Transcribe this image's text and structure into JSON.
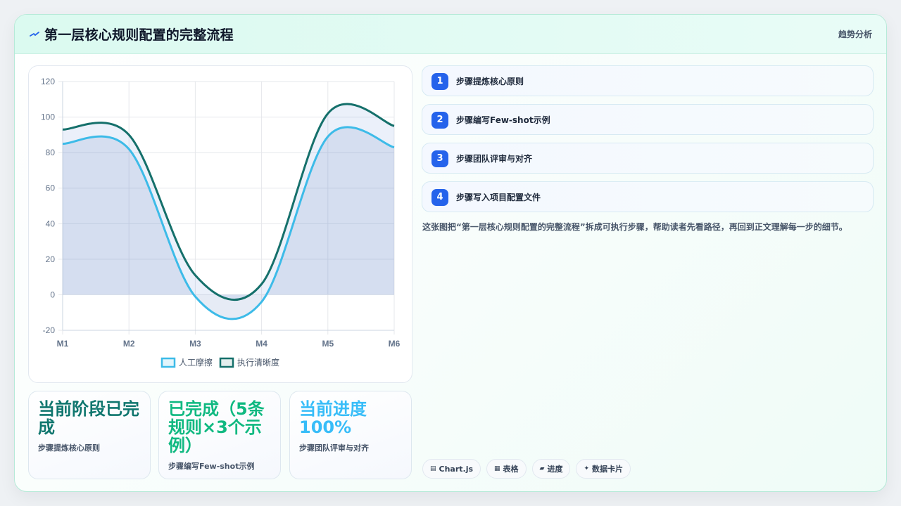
{
  "header": {
    "title": "第一层核心规则配置的完整流程",
    "tag": "趋势分析",
    "icon": "sparkle-icon"
  },
  "chart_data": {
    "type": "line",
    "categories": [
      "M1",
      "M2",
      "M3",
      "M4",
      "M5",
      "M6"
    ],
    "series": [
      {
        "name": "人工摩擦",
        "color": "#3dbbe8",
        "values": [
          85,
          82,
          -1,
          -4,
          89,
          83
        ]
      },
      {
        "name": "执行清晰度",
        "color": "#15706b",
        "values": [
          93,
          90,
          11,
          6,
          102,
          95
        ]
      }
    ],
    "ylim": [
      -20,
      120
    ],
    "yticks": [
      -20,
      0,
      20,
      40,
      60,
      80,
      100,
      120
    ],
    "grid": true,
    "legend": "bottom",
    "smooth": true,
    "fill": true
  },
  "steps": [
    {
      "num": "1",
      "label": "步骤提炼核心原则"
    },
    {
      "num": "2",
      "label": "步骤编写Few-shot示例"
    },
    {
      "num": "3",
      "label": "步骤团队评审与对齐"
    },
    {
      "num": "4",
      "label": "步骤写入项目配置文件"
    }
  ],
  "description": "这张图把“第一层核心规则配置的完整流程”拆成可执行步骤，帮助读者先看路径，再回到正文理解每一步的细节。",
  "stats": [
    {
      "big": "当前阶段已完成",
      "small": "步骤提炼核心原则",
      "color": "#0f766e"
    },
    {
      "big": "已完成（5条规则×3个示例）",
      "small": "步骤编写Few-shot示例",
      "color": "#10b981"
    },
    {
      "big": "当前进度100%",
      "small": "步骤团队评审与对齐",
      "color": "#38bdf8"
    }
  ],
  "chips": [
    {
      "icon": "▤",
      "label": "Chart.js"
    },
    {
      "icon": "▦",
      "label": "表格"
    },
    {
      "icon": "▰",
      "label": "进度"
    },
    {
      "icon": "✦",
      "label": "数据卡片"
    }
  ]
}
